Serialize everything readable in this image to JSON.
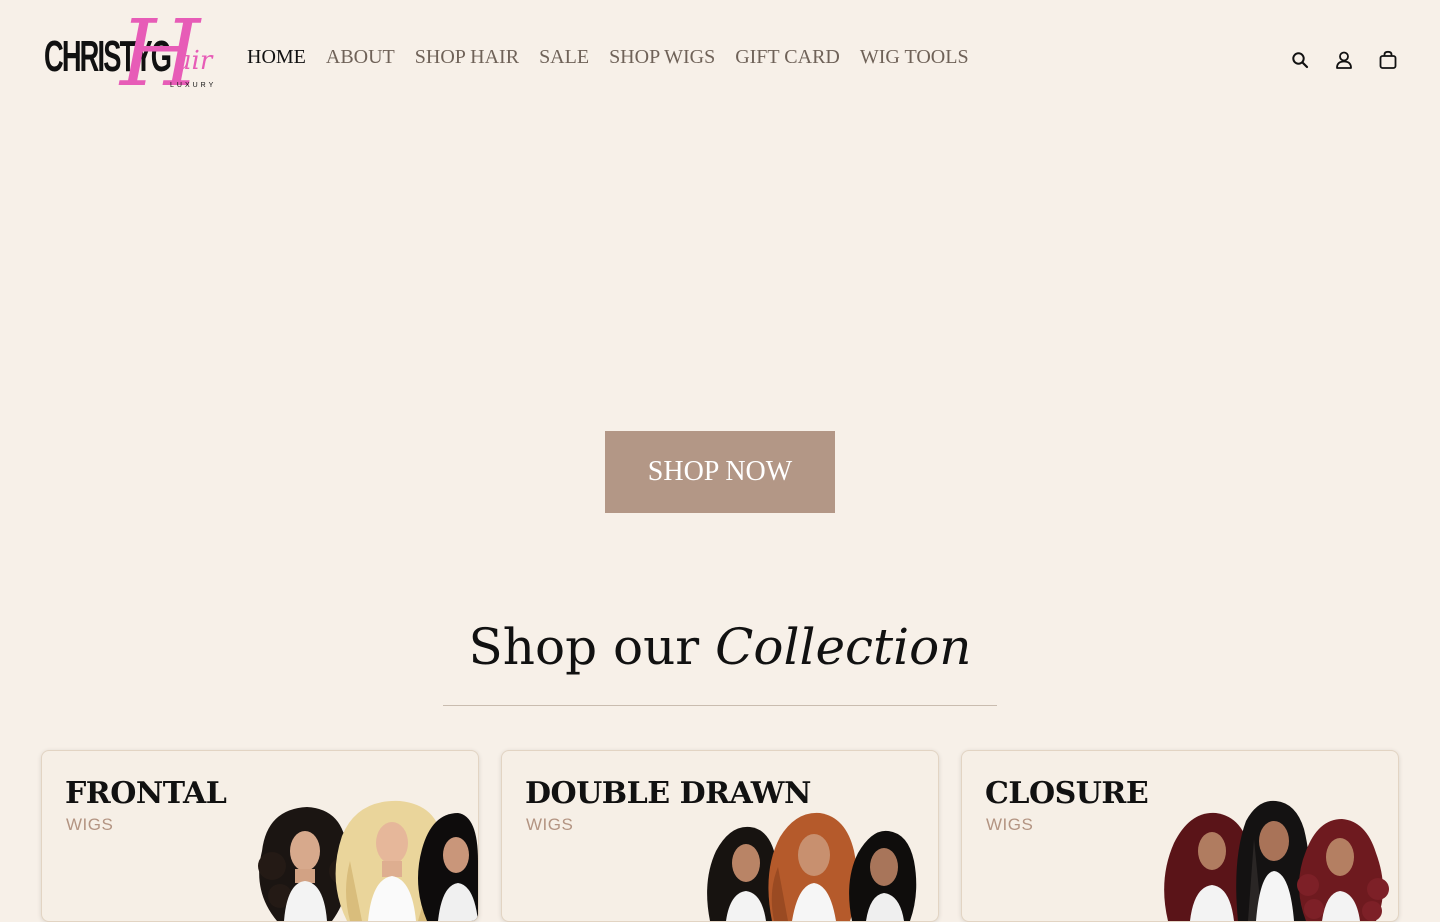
{
  "logo": {
    "main": "CHRISTYG",
    "script_initial": "H",
    "script_rest": "air",
    "sub": "LUXURY"
  },
  "nav": {
    "items": [
      "HOME",
      "ABOUT",
      "SHOP HAIR",
      "SALE",
      "SHOP WIGS",
      "GIFT CARD",
      "WIG TOOLS"
    ]
  },
  "icons": [
    "search-icon",
    "account-icon",
    "cart-icon"
  ],
  "hero": {
    "button_label": "SHOP NOW"
  },
  "collection": {
    "title_regular": "Shop our ",
    "title_italic": "Collection"
  },
  "cards": [
    {
      "title": "FRONTAL",
      "subtitle": "WIGS"
    },
    {
      "title": "DOUBLE DRAWN",
      "subtitle": "WIGS"
    },
    {
      "title": "CLOSURE",
      "subtitle": "WIGS"
    }
  ],
  "colors": {
    "background": "#f7f0e8",
    "accent_button": "#b39786",
    "logo_pink": "#e75cb7",
    "subtitle_tan": "#b39482"
  }
}
